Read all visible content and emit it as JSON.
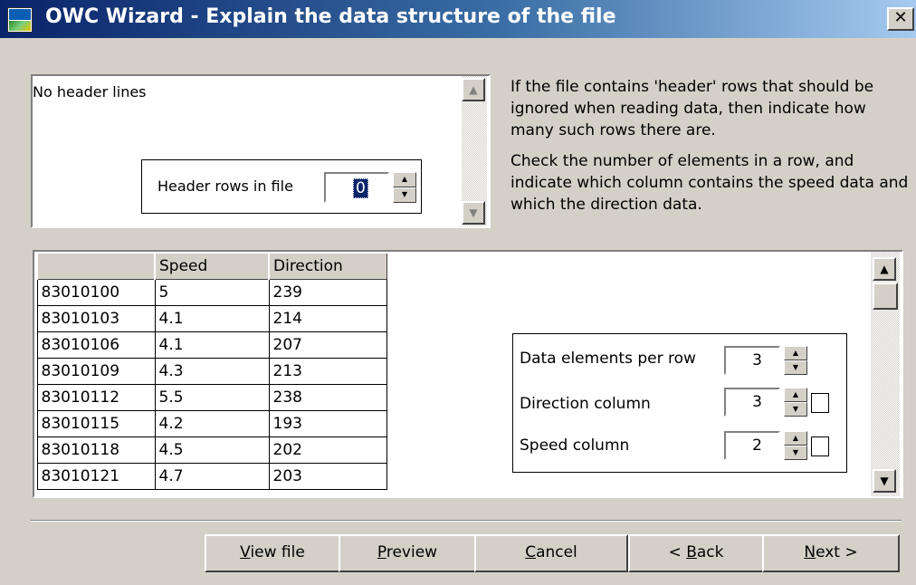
{
  "window": {
    "title": "OWC Wizard - Explain the data structure of the file",
    "close_label": "✕"
  },
  "header_section": {
    "preview_text": "No header lines",
    "header_rows_label": "Header rows in file",
    "header_rows_value": "0"
  },
  "instructions": {
    "para1": "If the file contains 'header' rows that should be ignored when reading data, then indicate how many such rows there are.",
    "para2": "Check the number of elements in a row, and indicate which column contains the speed data and which the direction data."
  },
  "grid": {
    "columns": [
      "",
      "Speed",
      "Direction"
    ],
    "rows": [
      [
        "83010100",
        "5",
        "239"
      ],
      [
        "83010103",
        "4.1",
        "214"
      ],
      [
        "83010106",
        "4.1",
        "207"
      ],
      [
        "83010109",
        "4.3",
        "213"
      ],
      [
        "83010112",
        "5.5",
        "238"
      ],
      [
        "83010115",
        "4.2",
        "193"
      ],
      [
        "83010118",
        "4.5",
        "202"
      ],
      [
        "83010121",
        "4.7",
        "203"
      ]
    ]
  },
  "params": {
    "elements_label": "Data elements per row",
    "elements_value": "3",
    "direction_label": "Direction column",
    "direction_value": "3",
    "speed_label": "Speed column",
    "speed_value": "2"
  },
  "buttons": {
    "view_file": {
      "mnemonic": "V",
      "rest": "iew file"
    },
    "preview": {
      "mnemonic": "P",
      "rest": "review"
    },
    "cancel": {
      "mnemonic": "C",
      "rest": "ancel"
    },
    "back": {
      "pre": "< ",
      "mnemonic": "B",
      "rest": "ack"
    },
    "next": {
      "mnemonic": "N",
      "rest": "ext >"
    }
  }
}
